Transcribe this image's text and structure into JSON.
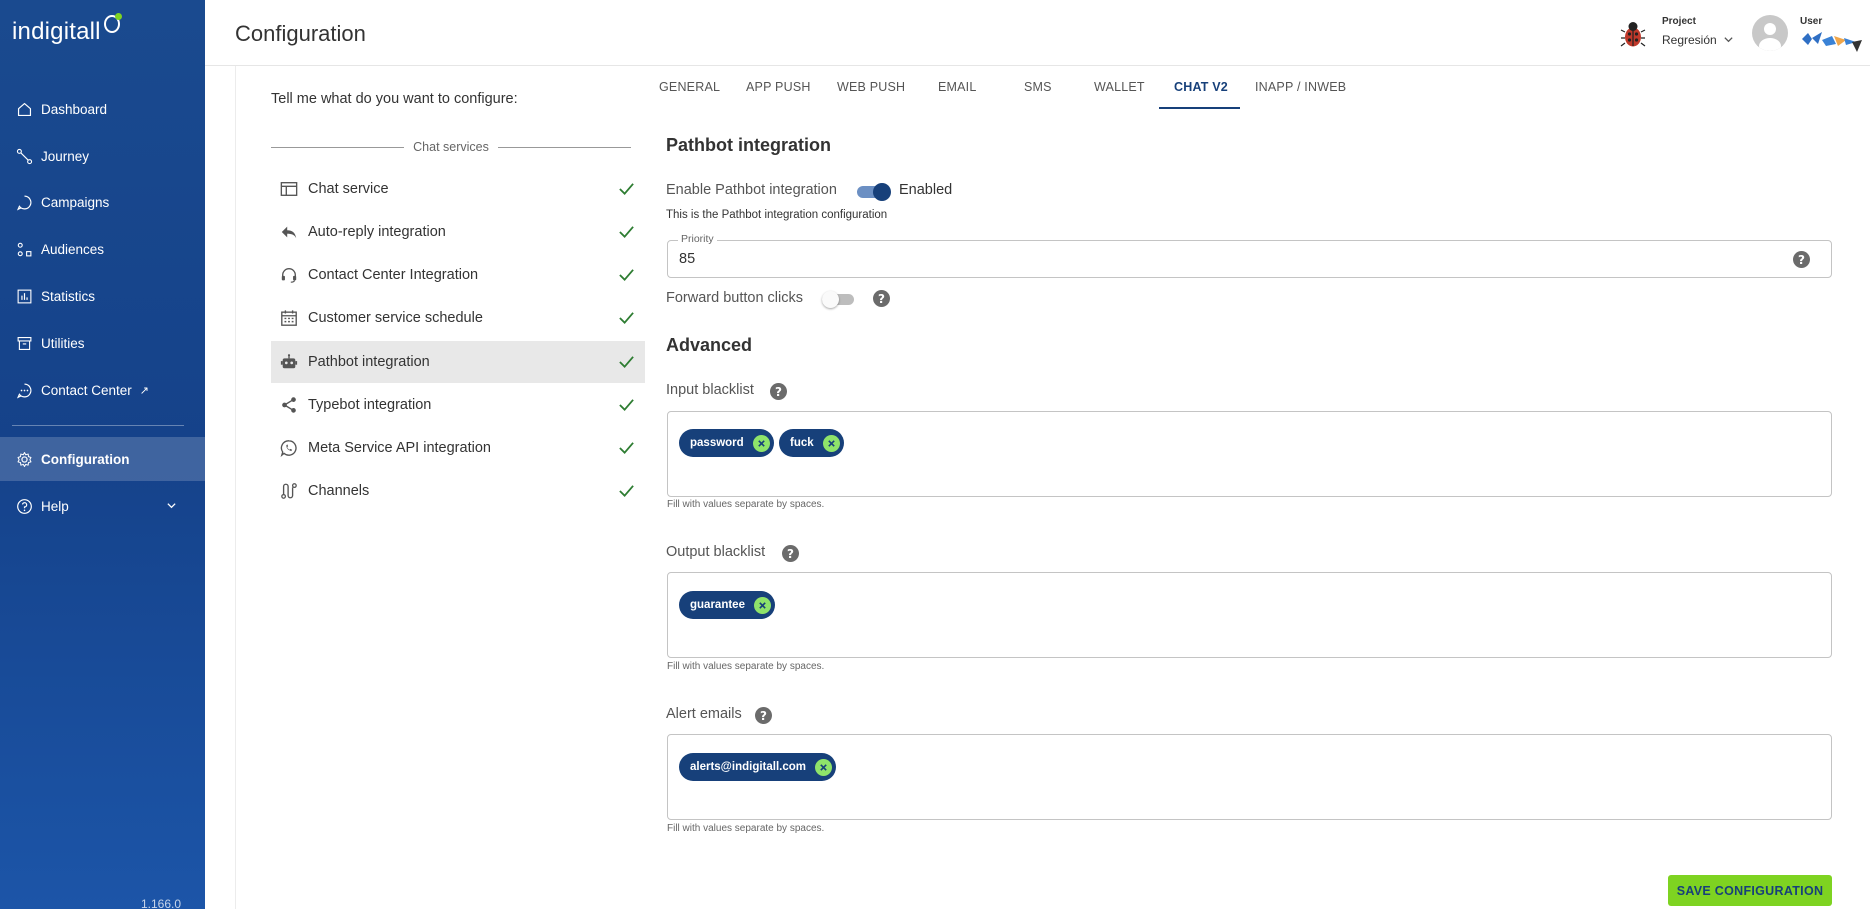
{
  "brand": {
    "logo_text": "indigitall",
    "accent": "#7ed321",
    "primary": "#17407a"
  },
  "sidebar": {
    "items": [
      {
        "label": "Dashboard",
        "icon": "home-icon"
      },
      {
        "label": "Journey",
        "icon": "journey-icon"
      },
      {
        "label": "Campaigns",
        "icon": "chat-bubble-icon"
      },
      {
        "label": "Audiences",
        "icon": "audiences-icon"
      },
      {
        "label": "Statistics",
        "icon": "bar-chart-icon"
      },
      {
        "label": "Utilities",
        "icon": "archive-icon"
      },
      {
        "label": "Contact Center",
        "icon": "chat-dots-icon",
        "external": "↗"
      },
      {
        "label": "Configuration",
        "icon": "gear-icon",
        "active": true
      },
      {
        "label": "Help",
        "icon": "help-circle-icon"
      }
    ],
    "version": "1.166.0"
  },
  "header": {
    "title": "Configuration",
    "project_label": "Project",
    "project_value": "Regresión",
    "user_label": "User"
  },
  "left": {
    "question": "Tell me what do you want to configure:",
    "section": "Chat services",
    "services": [
      {
        "label": "Chat service",
        "icon": "window-icon"
      },
      {
        "label": "Auto-reply integration",
        "icon": "reply-icon"
      },
      {
        "label": "Contact Center Integration",
        "icon": "headset-icon"
      },
      {
        "label": "Customer service schedule",
        "icon": "calendar-icon"
      },
      {
        "label": "Pathbot integration",
        "icon": "robot-icon",
        "active": true
      },
      {
        "label": "Typebot integration",
        "icon": "share-icon"
      },
      {
        "label": "Meta Service API integration",
        "icon": "whatsapp-icon"
      },
      {
        "label": "Channels",
        "icon": "route-icon"
      }
    ]
  },
  "tabs": [
    "GENERAL",
    "APP PUSH",
    "WEB PUSH",
    "EMAIL",
    "SMS",
    "WALLET",
    "CHAT V2",
    "INAPP / INWEB"
  ],
  "active_tab": "CHAT V2",
  "pathbot": {
    "heading": "Pathbot integration",
    "enable_label": "Enable Pathbot integration",
    "enable_state": "Enabled",
    "description": "This is the Pathbot integration configuration",
    "priority_label": "Priority",
    "priority_value": "85",
    "forward_label": "Forward button clicks",
    "advanced_heading": "Advanced",
    "input_blacklist": {
      "label": "Input blacklist",
      "chips": [
        "password",
        "fuck"
      ],
      "hint": "Fill with values separate by spaces."
    },
    "output_blacklist": {
      "label": "Output blacklist",
      "chips": [
        "guarantee"
      ],
      "hint": "Fill with values separate by spaces."
    },
    "alert_emails": {
      "label": "Alert emails",
      "chips": [
        "alerts@indigitall.com"
      ],
      "hint": "Fill with values separate by spaces."
    },
    "save_label": "SAVE CONFIGURATION"
  }
}
